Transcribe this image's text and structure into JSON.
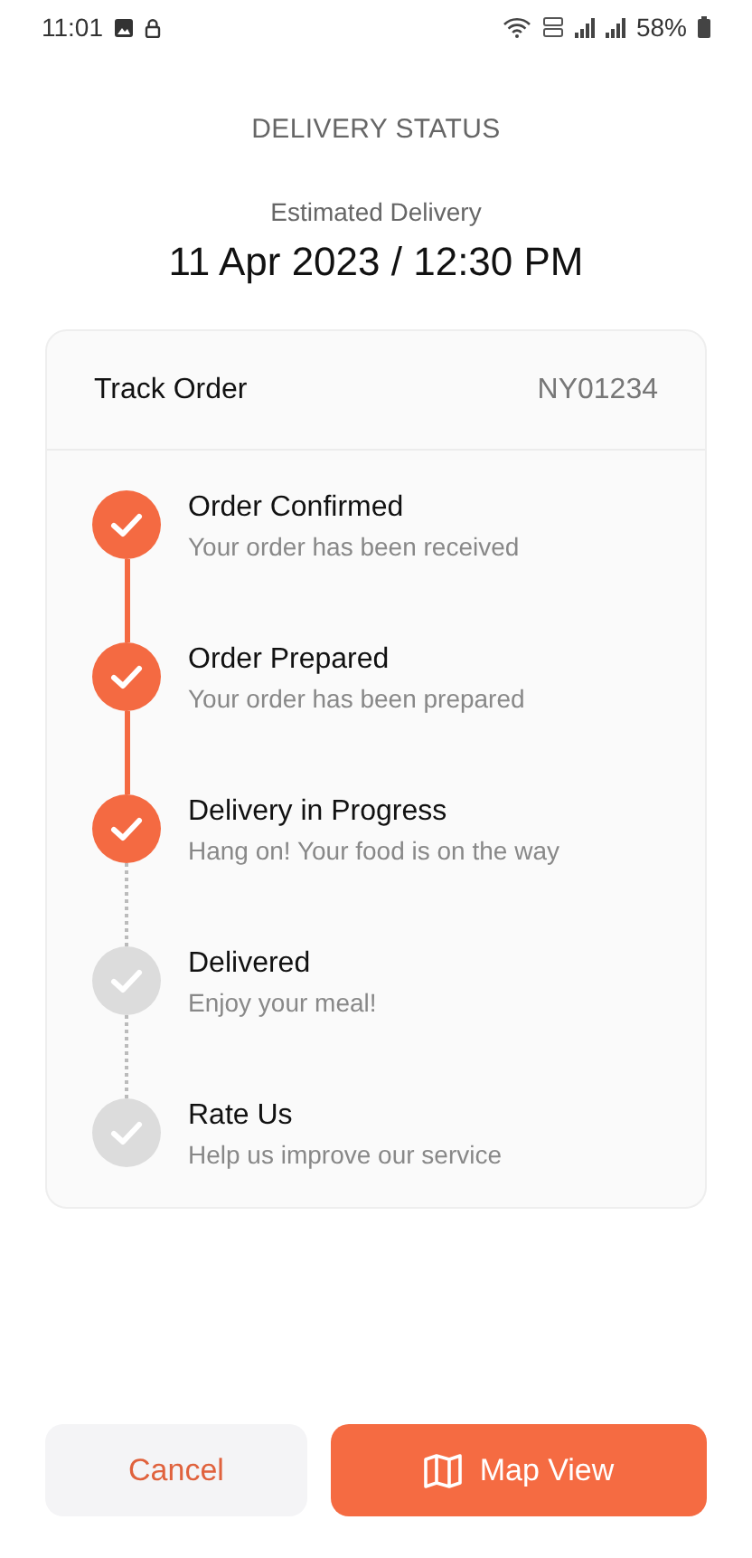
{
  "status_bar": {
    "time": "11:01",
    "battery": "58%"
  },
  "title": "DELIVERY STATUS",
  "estimate": {
    "label": "Estimated Delivery",
    "value": "11 Apr 2023 / 12:30 PM"
  },
  "card": {
    "title": "Track Order",
    "order_id": "NY01234"
  },
  "steps": [
    {
      "title": "Order Confirmed",
      "subtitle": "Your order has been received",
      "done": true
    },
    {
      "title": "Order Prepared",
      "subtitle": "Your order has been prepared",
      "done": true
    },
    {
      "title": "Delivery in Progress",
      "subtitle": "Hang on! Your food is on the way",
      "done": true
    },
    {
      "title": "Delivered",
      "subtitle": "Enjoy your meal!",
      "done": false
    },
    {
      "title": "Rate Us",
      "subtitle": "Help us improve our service",
      "done": false
    }
  ],
  "buttons": [
    {
      "label": "Cancel",
      "kind": "secondary"
    },
    {
      "label": "Map View",
      "kind": "primary"
    }
  ]
}
